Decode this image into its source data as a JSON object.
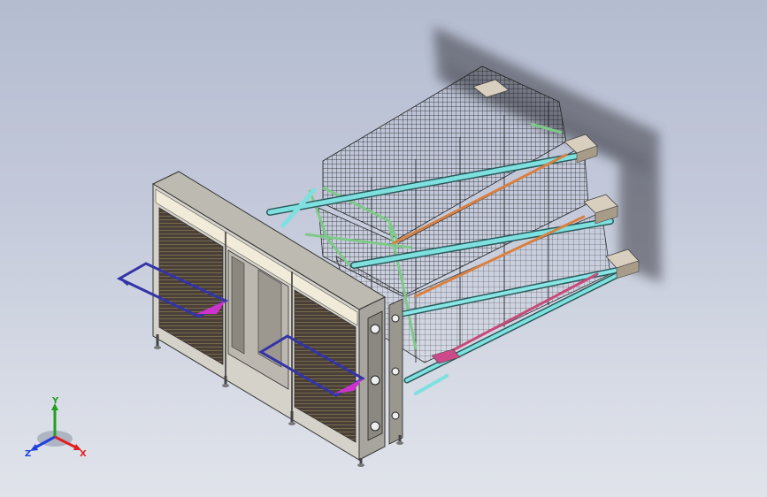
{
  "viewport": {
    "background_top": "#b4bcd0",
    "background_bottom": "#e0e3ea"
  },
  "model": {
    "description_icon": "poultry-cage-assembly-icon",
    "colors": {
      "cabinet": "#d9d6d0",
      "cabinet_edge": "#3a3a3a",
      "cabinet_top": "#f1ecd9",
      "rail": "#7fe0e0",
      "frame_green": "#7ec98a",
      "mesh": "#2a2a2a",
      "feed_trough": "#d98040",
      "feed_trough_low": "#c84a7a",
      "arm": "#3434a8",
      "arm_tip": "#cc33cc",
      "end_block": "#d8cfbf"
    }
  },
  "triad": {
    "x_label": "X",
    "y_label": "Y",
    "z_label": "Z",
    "x_color": "#e02020",
    "y_color": "#20a020",
    "z_color": "#2040e0"
  }
}
